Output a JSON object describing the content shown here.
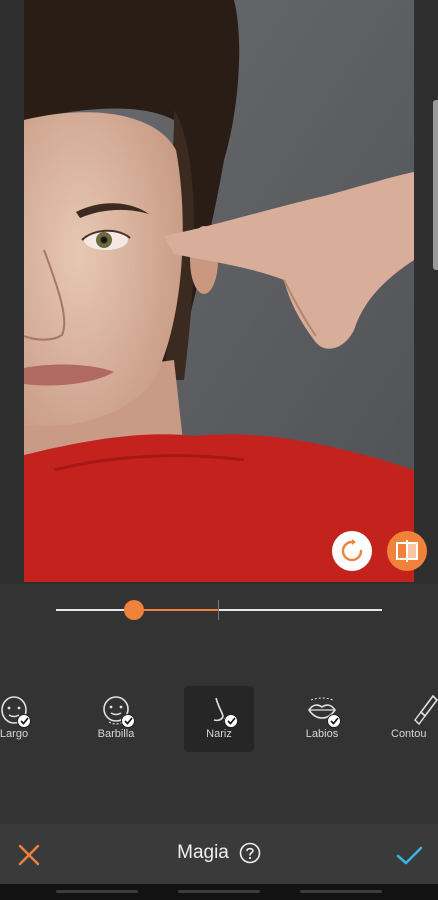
{
  "editor": {
    "tool_title": "Magia",
    "accent_color": "#f0823c",
    "confirm_color": "#3ab4e0"
  },
  "slider": {
    "value_fraction": 0.24,
    "center_fraction": 0.5
  },
  "tools": [
    {
      "label": "Largo",
      "icon": "face-long-icon",
      "selected": false
    },
    {
      "label": "Barbilla",
      "icon": "chin-icon",
      "selected": false
    },
    {
      "label": "Nariz",
      "icon": "nose-icon",
      "selected": true
    },
    {
      "label": "Labios",
      "icon": "lips-icon",
      "selected": false
    },
    {
      "label": "Contou",
      "icon": "contour-brush-icon",
      "selected": false
    }
  ],
  "buttons": {
    "cancel_icon": "close-icon",
    "confirm_icon": "checkmark-icon",
    "help_icon": "question-icon",
    "reset_icon": "reset-icon",
    "compare_icon": "compare-icon"
  }
}
